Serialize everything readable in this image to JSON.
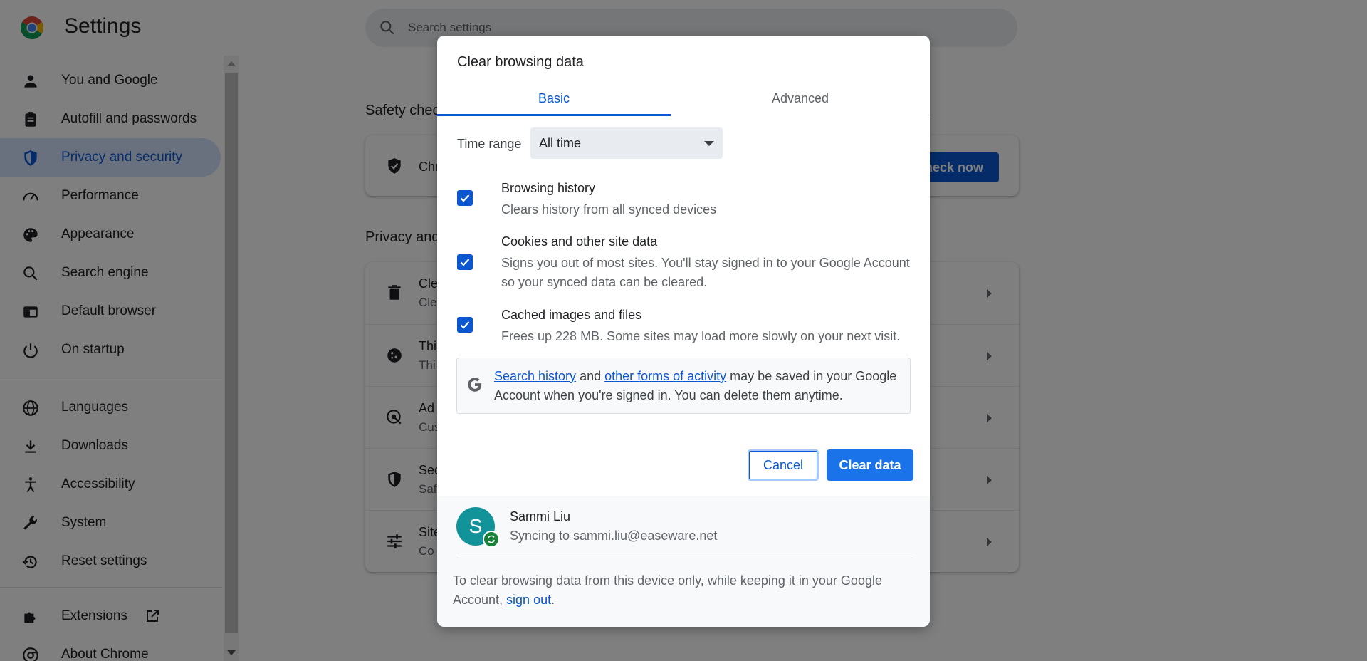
{
  "app": {
    "title": "Settings"
  },
  "search": {
    "placeholder": "Search settings"
  },
  "sidebar": {
    "items": [
      {
        "label": "You and Google",
        "icon": "person-icon"
      },
      {
        "label": "Autofill and passwords",
        "icon": "clipboard-icon"
      },
      {
        "label": "Privacy and security",
        "icon": "shield-icon",
        "active": true
      },
      {
        "label": "Performance",
        "icon": "speedometer-icon"
      },
      {
        "label": "Appearance",
        "icon": "palette-icon"
      },
      {
        "label": "Search engine",
        "icon": "search-icon"
      },
      {
        "label": "Default browser",
        "icon": "browser-icon"
      },
      {
        "label": "On startup",
        "icon": "power-icon"
      },
      {
        "label": "Languages",
        "icon": "globe-icon"
      },
      {
        "label": "Downloads",
        "icon": "download-icon"
      },
      {
        "label": "Accessibility",
        "icon": "accessibility-icon"
      },
      {
        "label": "System",
        "icon": "wrench-icon"
      },
      {
        "label": "Reset settings",
        "icon": "history-icon"
      },
      {
        "label": "Extensions",
        "icon": "puzzle-icon"
      },
      {
        "label": "About Chrome",
        "icon": "chrome-icon"
      }
    ]
  },
  "main": {
    "safety_title": "Safety chec",
    "safety_text": "Chr",
    "check_now": "Check now",
    "privacy_title": "Privacy and",
    "rows": [
      {
        "title": "Cle",
        "sub": "Cle"
      },
      {
        "title": "Thi",
        "sub": "Thi"
      },
      {
        "title": "Ad",
        "sub": "Cus"
      },
      {
        "title": "Sec",
        "sub": "Saf"
      },
      {
        "title": "Site",
        "sub": "Co"
      }
    ]
  },
  "dialog": {
    "title": "Clear browsing data",
    "tabs": {
      "basic": "Basic",
      "advanced": "Advanced"
    },
    "time_range_label": "Time range",
    "time_range_value": "All time",
    "options": [
      {
        "title": "Browsing history",
        "desc": "Clears history from all synced devices",
        "checked": true
      },
      {
        "title": "Cookies and other site data",
        "desc": "Signs you out of most sites. You'll stay signed in to your Google Account so your synced data can be cleared.",
        "checked": true
      },
      {
        "title": "Cached images and files",
        "desc": "Frees up 228 MB. Some sites may load more slowly on your next visit.",
        "checked": true
      }
    ],
    "google_note": {
      "link1": "Search history",
      "and": " and ",
      "link2": "other forms of activity",
      "rest": " may be saved in your Google Account when you're signed in. You can delete them anytime."
    },
    "cancel": "Cancel",
    "clear": "Clear data",
    "account": {
      "initial": "S",
      "name": "Sammi Liu",
      "sync": "Syncing to sammi.liu@easeware.net"
    },
    "footer_note": {
      "text": "To clear browsing data from this device only, while keeping it in your Google Account, ",
      "link": "sign out",
      "end": "."
    }
  },
  "colors": {
    "accent": "#0b57d0",
    "button": "#1a73e8",
    "avatar": "#12939a",
    "sync": "#188038"
  }
}
